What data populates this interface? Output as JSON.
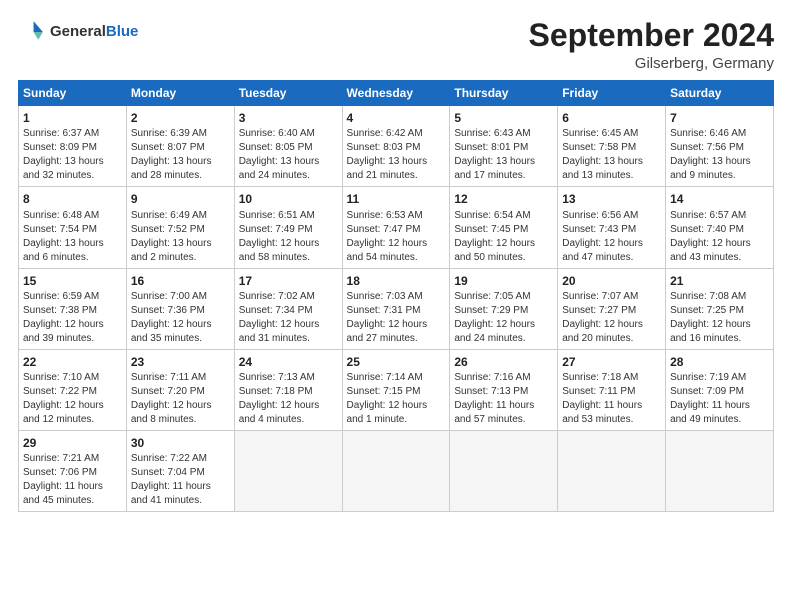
{
  "header": {
    "logo_general": "General",
    "logo_blue": "Blue",
    "title": "September 2024",
    "subtitle": "Gilserberg, Germany"
  },
  "columns": [
    "Sunday",
    "Monday",
    "Tuesday",
    "Wednesday",
    "Thursday",
    "Friday",
    "Saturday"
  ],
  "weeks": [
    [
      {
        "day": "1",
        "info": "Sunrise: 6:37 AM\nSunset: 8:09 PM\nDaylight: 13 hours\nand 32 minutes."
      },
      {
        "day": "2",
        "info": "Sunrise: 6:39 AM\nSunset: 8:07 PM\nDaylight: 13 hours\nand 28 minutes."
      },
      {
        "day": "3",
        "info": "Sunrise: 6:40 AM\nSunset: 8:05 PM\nDaylight: 13 hours\nand 24 minutes."
      },
      {
        "day": "4",
        "info": "Sunrise: 6:42 AM\nSunset: 8:03 PM\nDaylight: 13 hours\nand 21 minutes."
      },
      {
        "day": "5",
        "info": "Sunrise: 6:43 AM\nSunset: 8:01 PM\nDaylight: 13 hours\nand 17 minutes."
      },
      {
        "day": "6",
        "info": "Sunrise: 6:45 AM\nSunset: 7:58 PM\nDaylight: 13 hours\nand 13 minutes."
      },
      {
        "day": "7",
        "info": "Sunrise: 6:46 AM\nSunset: 7:56 PM\nDaylight: 13 hours\nand 9 minutes."
      }
    ],
    [
      {
        "day": "8",
        "info": "Sunrise: 6:48 AM\nSunset: 7:54 PM\nDaylight: 13 hours\nand 6 minutes."
      },
      {
        "day": "9",
        "info": "Sunrise: 6:49 AM\nSunset: 7:52 PM\nDaylight: 13 hours\nand 2 minutes."
      },
      {
        "day": "10",
        "info": "Sunrise: 6:51 AM\nSunset: 7:49 PM\nDaylight: 12 hours\nand 58 minutes."
      },
      {
        "day": "11",
        "info": "Sunrise: 6:53 AM\nSunset: 7:47 PM\nDaylight: 12 hours\nand 54 minutes."
      },
      {
        "day": "12",
        "info": "Sunrise: 6:54 AM\nSunset: 7:45 PM\nDaylight: 12 hours\nand 50 minutes."
      },
      {
        "day": "13",
        "info": "Sunrise: 6:56 AM\nSunset: 7:43 PM\nDaylight: 12 hours\nand 47 minutes."
      },
      {
        "day": "14",
        "info": "Sunrise: 6:57 AM\nSunset: 7:40 PM\nDaylight: 12 hours\nand 43 minutes."
      }
    ],
    [
      {
        "day": "15",
        "info": "Sunrise: 6:59 AM\nSunset: 7:38 PM\nDaylight: 12 hours\nand 39 minutes."
      },
      {
        "day": "16",
        "info": "Sunrise: 7:00 AM\nSunset: 7:36 PM\nDaylight: 12 hours\nand 35 minutes."
      },
      {
        "day": "17",
        "info": "Sunrise: 7:02 AM\nSunset: 7:34 PM\nDaylight: 12 hours\nand 31 minutes."
      },
      {
        "day": "18",
        "info": "Sunrise: 7:03 AM\nSunset: 7:31 PM\nDaylight: 12 hours\nand 27 minutes."
      },
      {
        "day": "19",
        "info": "Sunrise: 7:05 AM\nSunset: 7:29 PM\nDaylight: 12 hours\nand 24 minutes."
      },
      {
        "day": "20",
        "info": "Sunrise: 7:07 AM\nSunset: 7:27 PM\nDaylight: 12 hours\nand 20 minutes."
      },
      {
        "day": "21",
        "info": "Sunrise: 7:08 AM\nSunset: 7:25 PM\nDaylight: 12 hours\nand 16 minutes."
      }
    ],
    [
      {
        "day": "22",
        "info": "Sunrise: 7:10 AM\nSunset: 7:22 PM\nDaylight: 12 hours\nand 12 minutes."
      },
      {
        "day": "23",
        "info": "Sunrise: 7:11 AM\nSunset: 7:20 PM\nDaylight: 12 hours\nand 8 minutes."
      },
      {
        "day": "24",
        "info": "Sunrise: 7:13 AM\nSunset: 7:18 PM\nDaylight: 12 hours\nand 4 minutes."
      },
      {
        "day": "25",
        "info": "Sunrise: 7:14 AM\nSunset: 7:15 PM\nDaylight: 12 hours\nand 1 minute."
      },
      {
        "day": "26",
        "info": "Sunrise: 7:16 AM\nSunset: 7:13 PM\nDaylight: 11 hours\nand 57 minutes."
      },
      {
        "day": "27",
        "info": "Sunrise: 7:18 AM\nSunset: 7:11 PM\nDaylight: 11 hours\nand 53 minutes."
      },
      {
        "day": "28",
        "info": "Sunrise: 7:19 AM\nSunset: 7:09 PM\nDaylight: 11 hours\nand 49 minutes."
      }
    ],
    [
      {
        "day": "29",
        "info": "Sunrise: 7:21 AM\nSunset: 7:06 PM\nDaylight: 11 hours\nand 45 minutes."
      },
      {
        "day": "30",
        "info": "Sunrise: 7:22 AM\nSunset: 7:04 PM\nDaylight: 11 hours\nand 41 minutes."
      },
      {
        "day": "",
        "info": ""
      },
      {
        "day": "",
        "info": ""
      },
      {
        "day": "",
        "info": ""
      },
      {
        "day": "",
        "info": ""
      },
      {
        "day": "",
        "info": ""
      }
    ]
  ]
}
